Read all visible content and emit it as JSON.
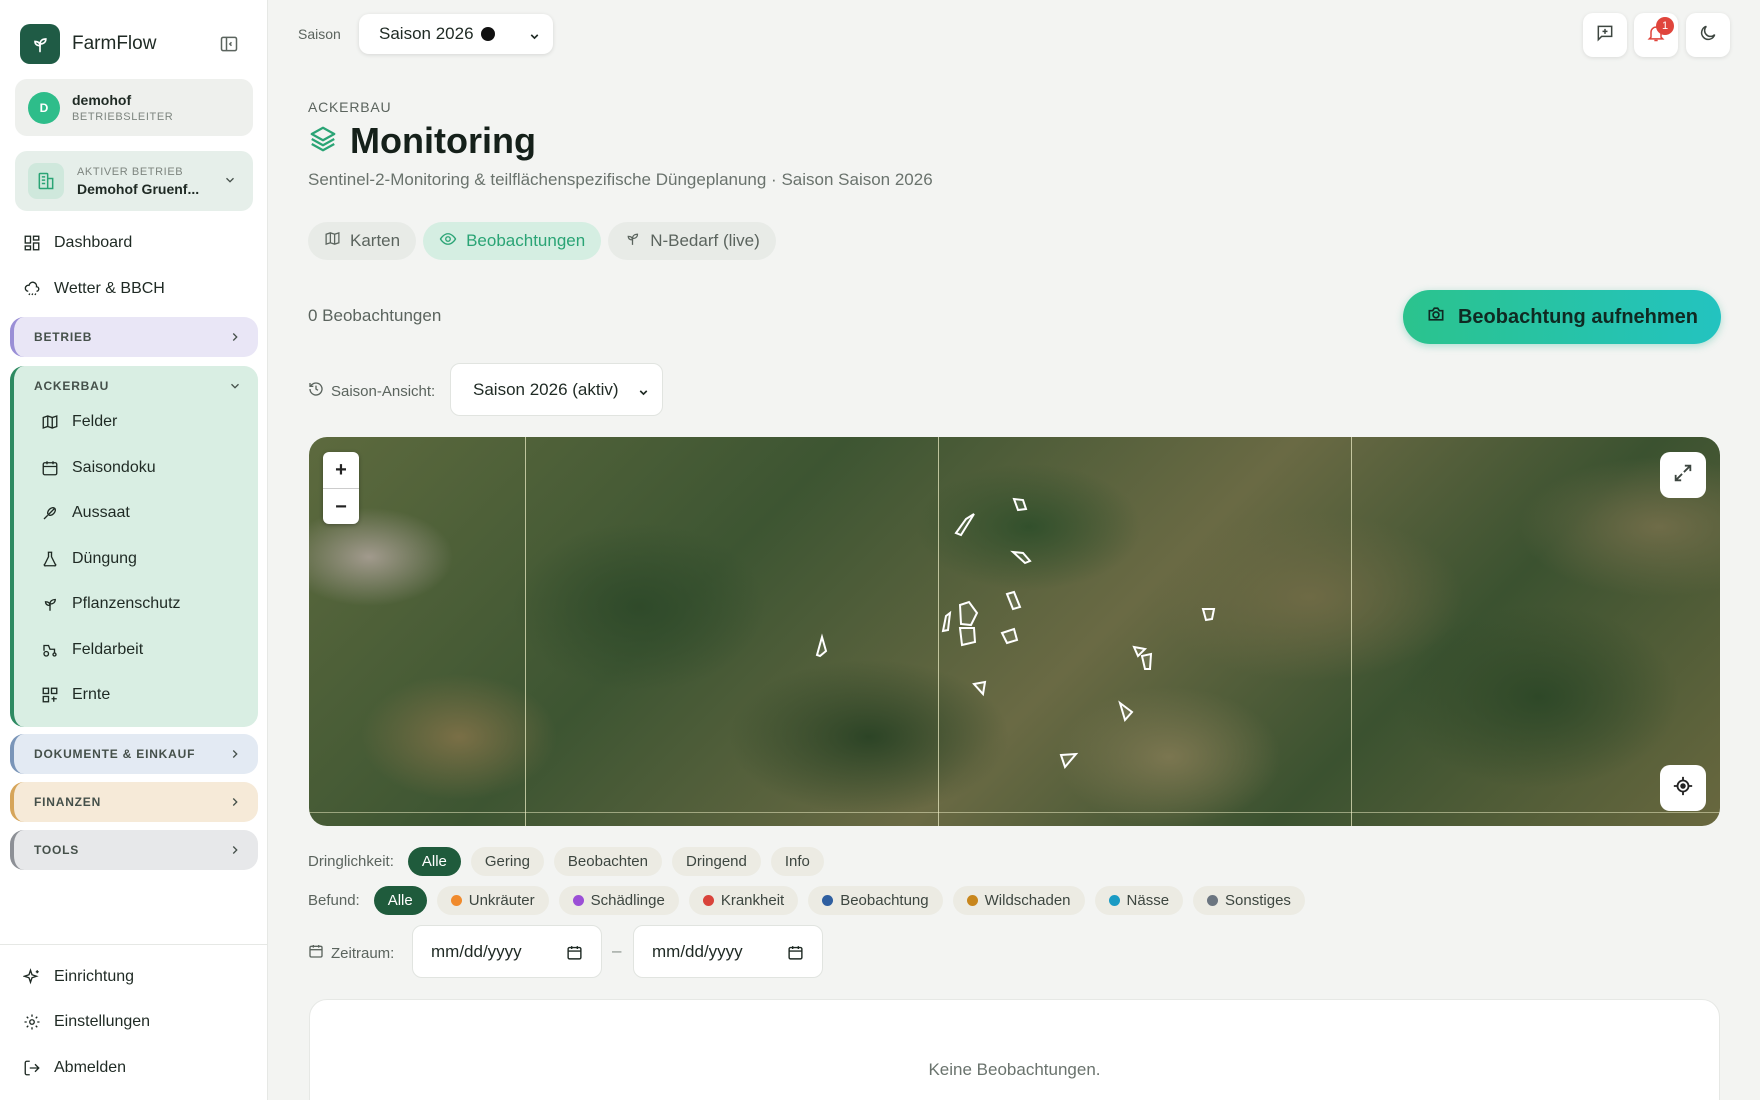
{
  "app": {
    "name": "FarmFlow"
  },
  "user": {
    "initial": "D",
    "name": "demohof",
    "role": "BETRIEBSLEITER"
  },
  "farm": {
    "label": "AKTIVER BETRIEB",
    "name": "Demohof Gruenf..."
  },
  "nav": {
    "dashboard": "Dashboard",
    "weather": "Wetter & BBCH"
  },
  "groups": {
    "betrieb": "BETRIEB",
    "ackerbau": "ACKERBAU",
    "dokumente": "DOKUMENTE & EINKAUF",
    "finanzen": "FINANZEN",
    "tools": "TOOLS"
  },
  "ackerbau_items": [
    "Felder",
    "Saisondoku",
    "Aussaat",
    "Düngung",
    "Pflanzenschutz",
    "Feldarbeit",
    "Ernte"
  ],
  "bottom_nav": {
    "setup": "Einrichtung",
    "settings": "Einstellungen",
    "logout": "Abmelden"
  },
  "topbar": {
    "season_label": "Saison",
    "season_value": "Saison 2026",
    "notification_count": "1"
  },
  "header": {
    "eyebrow": "ACKERBAU",
    "title": "Monitoring",
    "subtitle": "Sentinel-2-Monitoring & teilflächenspezifische Düngeplanung · Saison Saison 2026"
  },
  "tabs": [
    "Karten",
    "Beobachtungen",
    "N-Bedarf (live)"
  ],
  "active_tab": "Beobachtungen",
  "observations": {
    "count_text": "0 Beobachtungen",
    "add_button": "Beobachtung aufnehmen",
    "view_label": "Saison-Ansicht:",
    "view_value": "Saison 2026 (aktiv)",
    "empty_text": "Keine Beobachtungen."
  },
  "map": {
    "zoom_in": "+",
    "zoom_out": "−"
  },
  "filters": {
    "urgency_label": "Dringlichkeit:",
    "urgency": [
      "Alle",
      "Gering",
      "Beobachten",
      "Dringend",
      "Info"
    ],
    "finding_label": "Befund:",
    "findings": [
      {
        "label": "Alle",
        "color": ""
      },
      {
        "label": "Unkräuter",
        "color": "#f08a2c"
      },
      {
        "label": "Schädlinge",
        "color": "#9b4fd6"
      },
      {
        "label": "Krankheit",
        "color": "#d9433a"
      },
      {
        "label": "Beobachtung",
        "color": "#2f5fa0"
      },
      {
        "label": "Wildschaden",
        "color": "#c8861c"
      },
      {
        "label": "Nässe",
        "color": "#1a9bc4"
      },
      {
        "label": "Sonstiges",
        "color": "#6b7580"
      }
    ],
    "period_label": "Zeitraum:",
    "date_from": "mm/dd/yyyy",
    "date_to": "mm/dd/yyyy",
    "date_separator": "–"
  },
  "colors": {
    "accent": "#2bc38d",
    "brand": "#1f5b45",
    "active_chip": "#1f5b3c"
  }
}
